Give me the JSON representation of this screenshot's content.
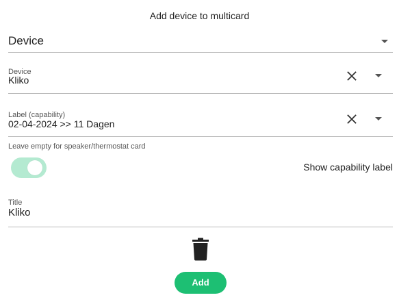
{
  "dialog": {
    "title": "Add device to multicard"
  },
  "device_select": {
    "value": "Device",
    "icon": "chevron-down-icon"
  },
  "device_field": {
    "label": "Device",
    "value": "Kliko",
    "clear_icon": "close-icon",
    "dropdown_icon": "chevron-down-icon"
  },
  "capability_field": {
    "label": "Label (capability)",
    "value": "02-04-2024 >> 11 Dagen",
    "clear_icon": "close-icon",
    "dropdown_icon": "chevron-down-icon"
  },
  "hint": {
    "text": "Leave empty for speaker/thermostat card"
  },
  "toggle": {
    "label": "Show capability label",
    "on": true,
    "color": "#b4ead1"
  },
  "title_field": {
    "label": "Title",
    "value": "Kliko"
  },
  "actions": {
    "delete_icon": "trash-icon",
    "add_label": "Add",
    "add_color": "#1dbf73"
  }
}
